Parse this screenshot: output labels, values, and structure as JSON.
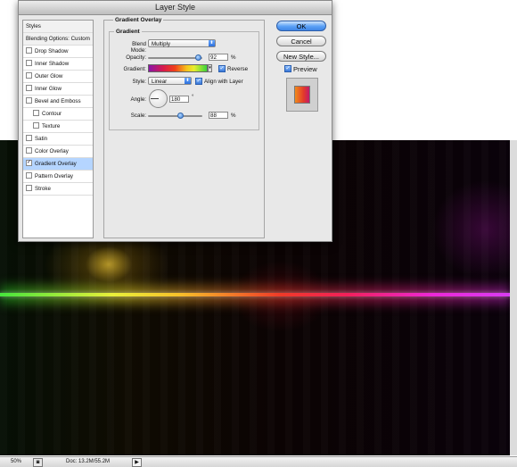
{
  "dialog": {
    "title": "Layer Style",
    "list": {
      "styles_header": "Styles",
      "blending_options": "Blending Options: Custom",
      "effects": [
        {
          "label": "Drop Shadow",
          "checked": false,
          "indent": false,
          "selected": false
        },
        {
          "label": "Inner Shadow",
          "checked": false,
          "indent": false,
          "selected": false
        },
        {
          "label": "Outer Glow",
          "checked": false,
          "indent": false,
          "selected": false
        },
        {
          "label": "Inner Glow",
          "checked": false,
          "indent": false,
          "selected": false
        },
        {
          "label": "Bevel and Emboss",
          "checked": false,
          "indent": false,
          "selected": false
        },
        {
          "label": "Contour",
          "checked": false,
          "indent": true,
          "selected": false
        },
        {
          "label": "Texture",
          "checked": false,
          "indent": true,
          "selected": false
        },
        {
          "label": "Satin",
          "checked": false,
          "indent": false,
          "selected": false
        },
        {
          "label": "Color Overlay",
          "checked": false,
          "indent": false,
          "selected": false
        },
        {
          "label": "Gradient Overlay",
          "checked": true,
          "indent": false,
          "selected": true
        },
        {
          "label": "Pattern Overlay",
          "checked": false,
          "indent": false,
          "selected": false
        },
        {
          "label": "Stroke",
          "checked": false,
          "indent": false,
          "selected": false
        }
      ]
    },
    "panel": {
      "title": "Gradient Overlay",
      "group_title": "Gradient",
      "blend_mode_label": "Blend Mode:",
      "blend_mode_value": "Multiply",
      "opacity_label": "Opacity:",
      "opacity_value": "92",
      "opacity_fraction": 0.92,
      "percent": "%",
      "gradient_label": "Gradient:",
      "reverse_label": "Reverse",
      "reverse_checked": true,
      "style_label": "Style:",
      "style_value": "Linear",
      "align_label": "Align with Layer",
      "align_checked": true,
      "angle_label": "Angle:",
      "angle_value": "180",
      "degree": "°",
      "scale_label": "Scale:",
      "scale_value": "88",
      "scale_fraction": 0.59
    },
    "buttons": {
      "ok": "OK",
      "cancel": "Cancel",
      "new_style": "New Style...",
      "preview_label": "Preview",
      "preview_checked": true
    }
  },
  "statusbar": {
    "zoom": "50%",
    "doc_info": "Doc: 13.2M/55.2M"
  },
  "icons": {
    "checkmark": "✓",
    "dropdown": "⬍",
    "play": "▶"
  },
  "colors": {
    "accent_blue": "#3f86e6",
    "selected_row": "#b5d5ff"
  }
}
